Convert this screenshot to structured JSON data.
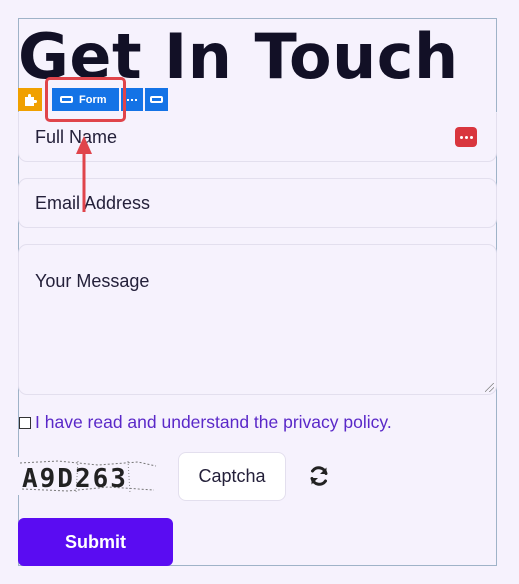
{
  "title": "Get In Touch",
  "toolbar": {
    "form_label": "Form"
  },
  "form": {
    "name_placeholder": "Full Name",
    "email_placeholder": "Email Address",
    "message_placeholder": "Your Message",
    "policy_text": "I have read and understand the privacy policy.",
    "captcha_text": "A9D263",
    "captcha_button": "Captcha",
    "submit_label": "Submit"
  },
  "colors": {
    "background": "#f6f2fd",
    "accent": "#5a0cf2",
    "link": "#5a28c8",
    "toolbar": "#1473e6",
    "highlight": "#e0444b"
  },
  "icons": [
    "plugin-icon",
    "input-field-icon",
    "more-dots-icon",
    "keyboard-icon",
    "refresh-icon"
  ]
}
